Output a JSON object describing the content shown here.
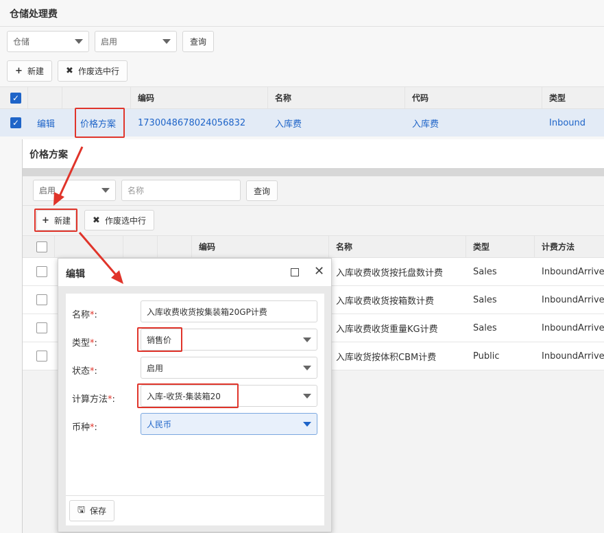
{
  "page": {
    "title": "仓储处理费",
    "filters": {
      "type": "仓储",
      "status": "启用",
      "query_label": "查询"
    },
    "toolbar": {
      "new_label": "新建",
      "void_label": "作废选中行"
    },
    "columns": [
      "编码",
      "名称",
      "代码",
      "类型"
    ],
    "row": {
      "edit": "编辑",
      "pricing": "价格方案",
      "code": "1730048678024056832",
      "name": "入库费",
      "code2": "入库费",
      "type": "Inbound"
    }
  },
  "pricing_dialog": {
    "title": "价格方案",
    "filters": {
      "status": "启用",
      "name_placeholder": "名称",
      "query_label": "查询"
    },
    "toolbar": {
      "new_label": "新建",
      "void_label": "作废选中行"
    },
    "columns": [
      "编码",
      "名称",
      "类型",
      "计费方法"
    ],
    "rows": [
      {
        "name": "入库收费收货按托盘数计费",
        "type": "Sales",
        "method": "InboundArriveP"
      },
      {
        "name": "入库收费收货按箱数计费",
        "type": "Sales",
        "method": "InboundArriveC"
      },
      {
        "name": "入库收费收货重量KG计费",
        "type": "Sales",
        "method": "InboundArriveW"
      },
      {
        "name": "入库收货按体积CBM计费",
        "type": "Public",
        "method": "InboundArriveV"
      }
    ]
  },
  "edit_dialog": {
    "title": "编辑",
    "required_mark": "*",
    "fields": {
      "name": {
        "label": "名称",
        "value": "入库收费收货按集装箱20GP计费"
      },
      "type": {
        "label": "类型",
        "value": "销售价"
      },
      "status": {
        "label": "状态",
        "value": "启用"
      },
      "method": {
        "label": "计算方法",
        "value": "入库-收货-集装箱20"
      },
      "currency": {
        "label": "币种",
        "value": "人民币"
      }
    },
    "save_label": "保存"
  },
  "colors": {
    "accent": "#1e64c8",
    "annotation": "#e0342a"
  }
}
